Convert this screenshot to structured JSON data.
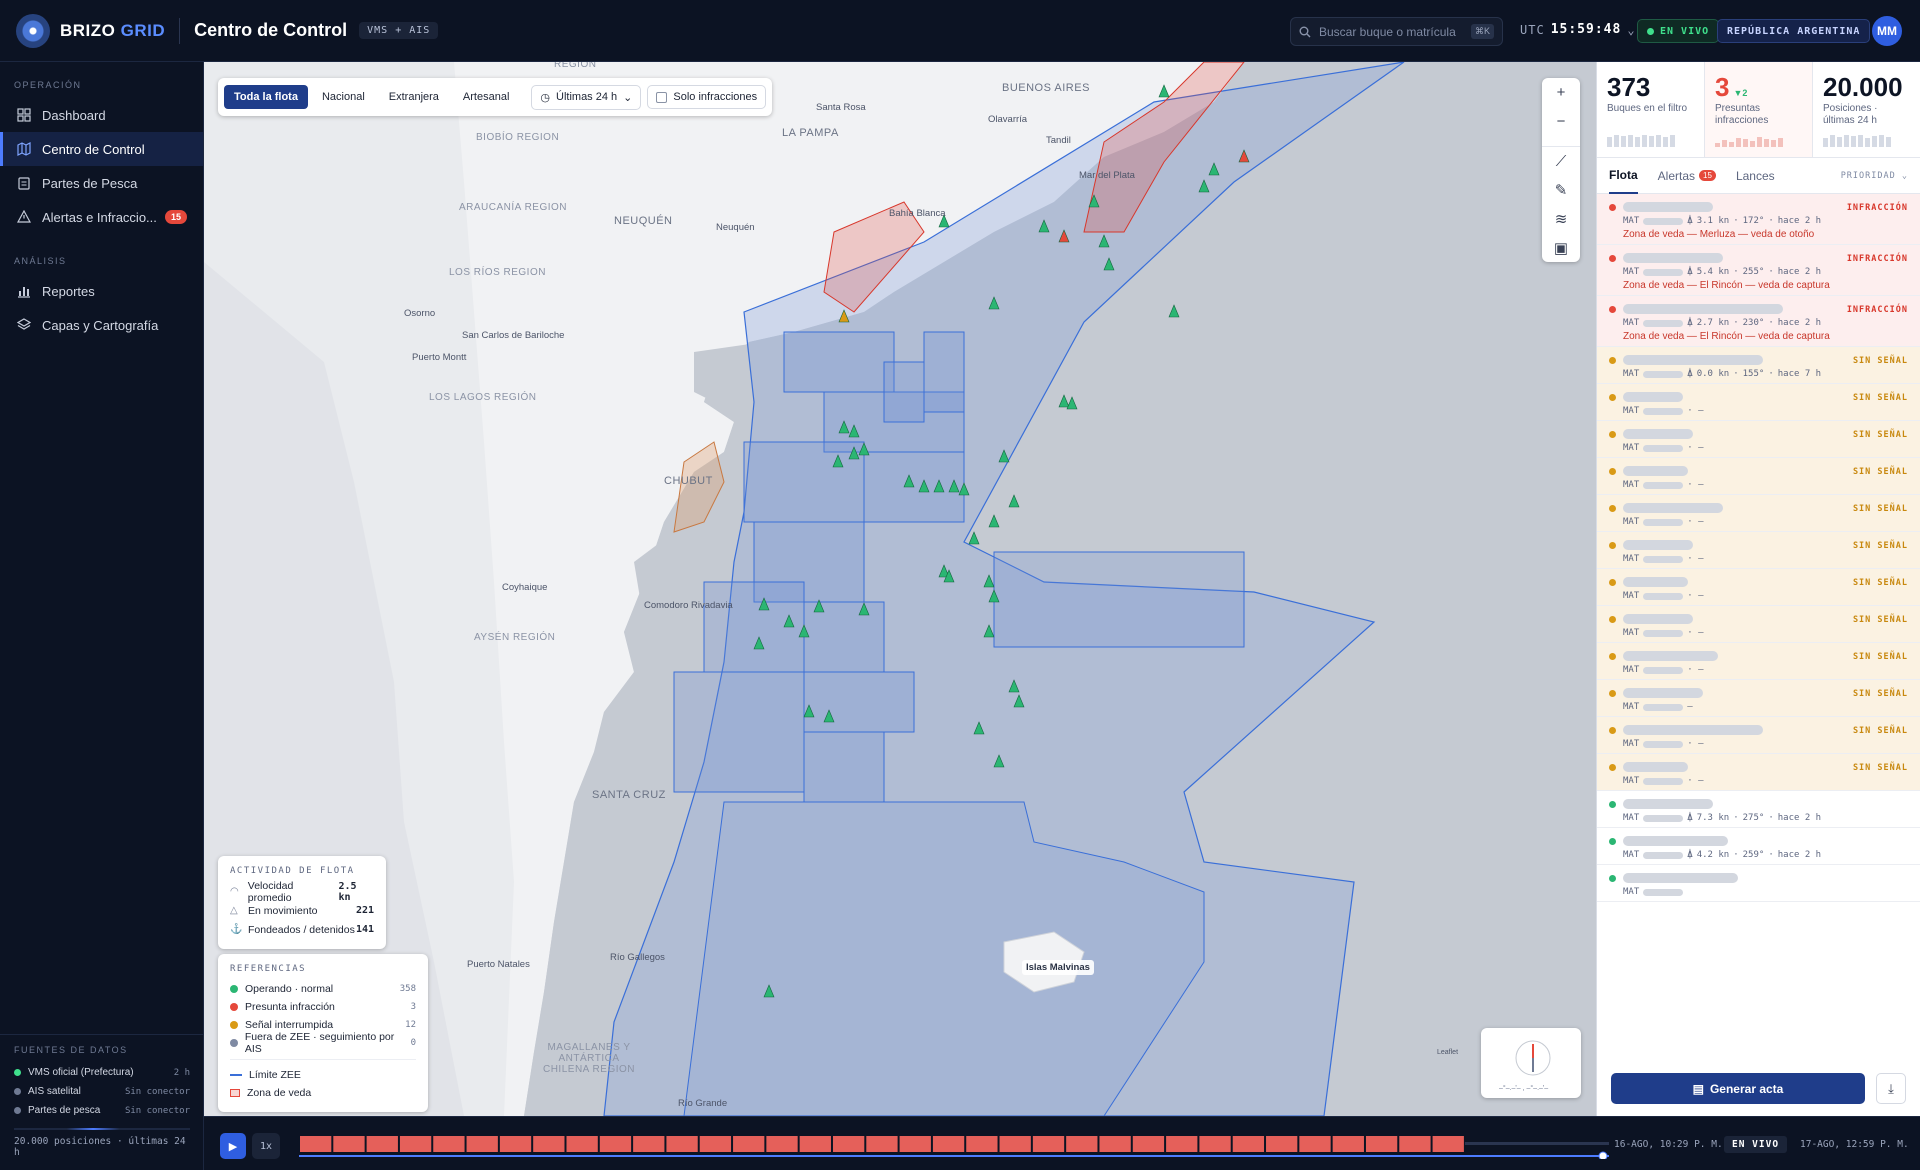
{
  "brand": {
    "name_a": "BRIZO",
    "name_b": "GRID"
  },
  "header": {
    "title": "Centro de Control",
    "tag": "VMS + AIS",
    "search_placeholder": "Buscar buque o matrícula",
    "search_kbd": "⌘K",
    "utc_label": "UTC",
    "utc_time": "15:59:48",
    "live": "EN VIVO",
    "country": "REPÚBLICA ARGENTINA",
    "avatar": "MM"
  },
  "sidebar": {
    "section_ops": "OPERACIÓN",
    "ops_items": [
      {
        "label": "Dashboard",
        "icon": "dashboard-icon"
      },
      {
        "label": "Centro de Control",
        "icon": "map-icon",
        "active": true
      },
      {
        "label": "Partes de Pesca",
        "icon": "clipboard-icon"
      },
      {
        "label": "Alertas e Infraccio...",
        "icon": "alert-icon",
        "badge": "15"
      }
    ],
    "section_analysis": "ANÁLISIS",
    "analysis_items": [
      {
        "label": "Reportes",
        "icon": "chart-icon"
      },
      {
        "label": "Capas y Cartografía",
        "icon": "layers-icon"
      }
    ],
    "sources_title": "FUENTES DE DATOS",
    "sources": [
      {
        "label": "VMS oficial (Prefectura)",
        "value": "2 h",
        "color": "#3fe08c"
      },
      {
        "label": "AIS satelital",
        "value": "Sin conector",
        "color": "#6f7a93"
      },
      {
        "label": "Partes de pesca",
        "value": "Sin conector",
        "color": "#6f7a93"
      }
    ],
    "sources_footer": "20.000 posiciones · últimas 24 h"
  },
  "map": {
    "filters": [
      "Toda la flota",
      "Nacional",
      "Extranjera",
      "Artesanal"
    ],
    "active_filter": "Toda la flota",
    "time_range": "Últimas 24 h",
    "only_infractions": "Solo infracciones",
    "only_infractions_checked": false,
    "labels": {
      "santa_rosa": "Santa Rosa",
      "la_pampa": "LA PAMPA",
      "buenos_aires": "BUENOS AIRES",
      "olavarria": "Olavarría",
      "tandil": "Tandil",
      "mar_del_plata": "Mar del Plata",
      "bahia_blanca": "Bahía Blanca",
      "neuquen_region": "NEUQUÉN",
      "neuquen_city": "Neuquén",
      "biobio": "BIOBÍO REGION",
      "araucania": "ARAUCANÍA REGION",
      "los_rios": "LOS RÍOS REGION",
      "osorno": "Osorno",
      "san_carlos": "San Carlos de Bariloche",
      "puerto_montt": "Puerto Montt",
      "los_lagos": "LOS LAGOS REGIÓN",
      "chubut": "CHUBUT",
      "coyhaique": "Coyhaique",
      "comodoro": "Comodoro Rivadavia",
      "aysen": "AYSÉN REGIÓN",
      "santa_cruz": "SANTA CRUZ",
      "rio_gallegos": "Río Gallegos",
      "puerto_natales": "Puerto Natales",
      "magallanes": "MAGALLANES Y ANTÁRTICA CHILENA REGION",
      "rio_grande": "Río Grande",
      "malvinas": "Islas Malvinas",
      "region_top": "REGION",
      "leaflet": "Leaflet"
    },
    "activity": {
      "title": "ACTIVIDAD DE FLOTA",
      "rows": [
        {
          "label": "Velocidad promedio",
          "value": "2.5 kn"
        },
        {
          "label": "En movimiento",
          "value": "221"
        },
        {
          "label": "Fondeados / detenidos",
          "value": "141"
        }
      ]
    },
    "legend": {
      "title": "REFERENCIAS",
      "rows": [
        {
          "label": "Operando · normal",
          "count": "358",
          "color": "#2bb673"
        },
        {
          "label": "Presunta infracción",
          "count": "3",
          "color": "#e5483b"
        },
        {
          "label": "Señal interrumpida",
          "count": "12",
          "color": "#d99a16"
        },
        {
          "label": "Fuera de ZEE · seguimiento por AIS",
          "count": "0",
          "color": "#7f8aa3"
        }
      ],
      "zee": "Límite ZEE",
      "veda": "Zona de veda"
    }
  },
  "rpanel": {
    "stats": [
      {
        "value": "373",
        "label": "Buques en el filtro"
      },
      {
        "value": "3",
        "delta": "▼2",
        "label": "Presuntas infracciones"
      },
      {
        "value": "20.000",
        "label": "Posiciones · últimas 24 h"
      }
    ],
    "tabs": {
      "fleet": "Flota",
      "alerts": "Alertas",
      "alerts_count": "15",
      "hauls": "Lances",
      "sort": "PRIORIDAD"
    },
    "vessels": [
      {
        "status": "INFRACCIÓN",
        "kind": "inf",
        "mat": "MAT",
        "speed": "3.1 kn",
        "course": "172°",
        "ago": "hace 2 h",
        "zone": "Zona de veda — Merluza — veda de otoño"
      },
      {
        "status": "INFRACCIÓN",
        "kind": "inf",
        "mat": "MAT",
        "speed": "5.4 kn",
        "course": "255°",
        "ago": "hace 2 h",
        "zone": "Zona de veda — El Rincón — veda de captura"
      },
      {
        "status": "INFRACCIÓN",
        "kind": "inf",
        "mat": "MAT",
        "speed": "2.7 kn",
        "course": "230°",
        "ago": "hace 2 h",
        "zone": "Zona de veda — El Rincón — veda de captura"
      },
      {
        "status": "SIN SEÑAL",
        "kind": "sig",
        "mat": "MAT",
        "speed": "0.0 kn",
        "course": "155°",
        "ago": "hace 7 h"
      },
      {
        "status": "SIN SEÑAL",
        "kind": "sig",
        "mat": "MAT",
        "dash": "· —"
      },
      {
        "status": "SIN SEÑAL",
        "kind": "sig",
        "mat": "MAT",
        "dash": "· —"
      },
      {
        "status": "SIN SEÑAL",
        "kind": "sig",
        "mat": "MAT",
        "dash": "· —"
      },
      {
        "status": "SIN SEÑAL",
        "kind": "sig",
        "mat": "MAT",
        "dash": "· —"
      },
      {
        "status": "SIN SEÑAL",
        "kind": "sig",
        "mat": "MAT",
        "dash": "· —"
      },
      {
        "status": "SIN SEÑAL",
        "kind": "sig",
        "mat": "MAT",
        "dash": "· —"
      },
      {
        "status": "SIN SEÑAL",
        "kind": "sig",
        "mat": "MAT",
        "dash": "· —"
      },
      {
        "status": "SIN SEÑAL",
        "kind": "sig",
        "mat": "MAT",
        "dash": "· —"
      },
      {
        "status": "SIN SEÑAL",
        "kind": "sig",
        "mat": "MAT",
        "dash": "—"
      },
      {
        "status": "SIN SEÑAL",
        "kind": "sig",
        "mat": "MAT",
        "dash": "· —"
      },
      {
        "status": "SIN SEÑAL",
        "kind": "sig",
        "mat": "MAT",
        "dash": "· —"
      },
      {
        "status": "",
        "kind": "ok",
        "mat": "MAT",
        "speed": "7.3 kn",
        "course": "275°",
        "ago": "hace 2 h"
      },
      {
        "status": "",
        "kind": "ok",
        "mat": "MAT",
        "speed": "4.2 kn",
        "course": "259°",
        "ago": "hace 2 h"
      },
      {
        "status": "",
        "kind": "ok",
        "mat": "MAT",
        "speed": "",
        "course": "",
        "ago": ""
      }
    ],
    "generate": "Generar acta"
  },
  "timeline": {
    "speed": "1x",
    "progress": 0.89,
    "start": "16-AGO, 10:29 P. M.",
    "live": "EN VIVO",
    "end": "17-AGO, 12:59 P. M."
  },
  "colors": {
    "accent": "#1f3d8a",
    "infraction": "#e5483b",
    "signal": "#d99a16",
    "ok": "#2bb673",
    "zone": "#3a6fd8"
  }
}
